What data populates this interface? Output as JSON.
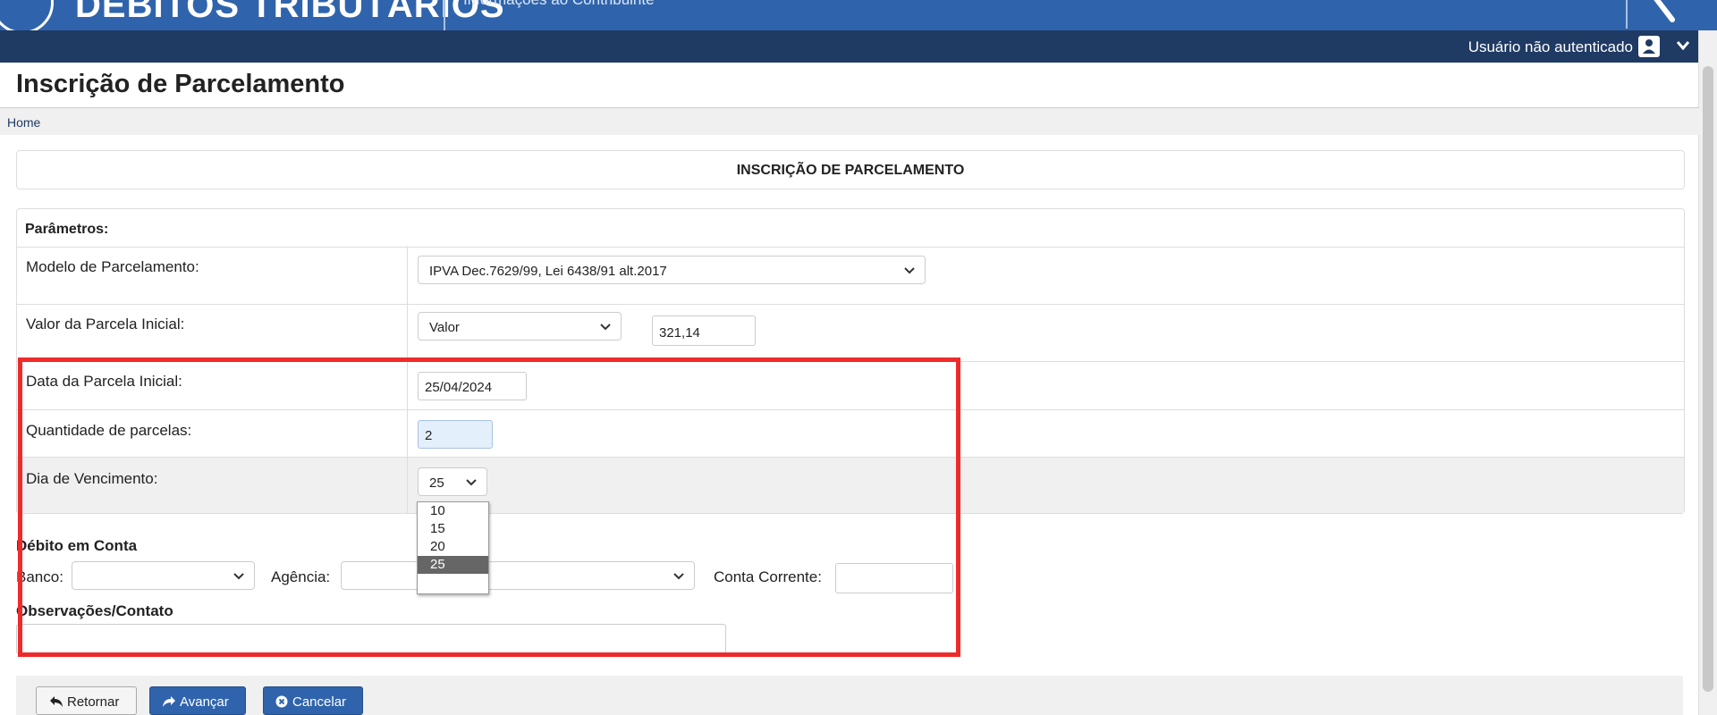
{
  "banner": {
    "title": "DÉBITOS TRIBUTÁRIOS",
    "subtitle": "Informações ao Contribuinte"
  },
  "userbar": {
    "user_label": "Usuário não autenticado"
  },
  "page": {
    "title": "Inscrição de Parcelamento",
    "breadcrumb": "Home"
  },
  "form": {
    "header": "INSCRIÇÃO DE PARCELAMENTO",
    "params_title": "Parâmetros:",
    "modelo": {
      "label": "Modelo de Parcelamento:",
      "value": "IPVA Dec.7629/99, Lei 6438/91 alt.2017"
    },
    "valor_inicial": {
      "label": "Valor da Parcela Inicial:",
      "type_value": "Valor",
      "amount": "321,14"
    },
    "data_inicial": {
      "label": "Data da Parcela Inicial:",
      "value": "25/04/2024"
    },
    "quantidade": {
      "label": "Quantidade de parcelas:",
      "value": "2"
    },
    "dia_vencimento": {
      "label": "Dia de Vencimento:",
      "value": "25",
      "options": [
        "10",
        "15",
        "20",
        "25"
      ],
      "selected_index": 3
    },
    "debito": {
      "title": "Débito em Conta",
      "banco_label": "Banco:",
      "banco_value": "",
      "agencia_label": "Agência:",
      "agencia_value": "",
      "conta_label": "Conta Corrente:",
      "conta_value": ""
    },
    "observacoes": {
      "title": "Observações/Contato",
      "value": ""
    }
  },
  "actions": {
    "retornar": "Retornar",
    "avancar": "Avançar",
    "cancelar": "Cancelar"
  },
  "colors": {
    "banner": "#2f64ac",
    "userbar": "#1f3a63",
    "highlight": "#ee2b2b"
  }
}
